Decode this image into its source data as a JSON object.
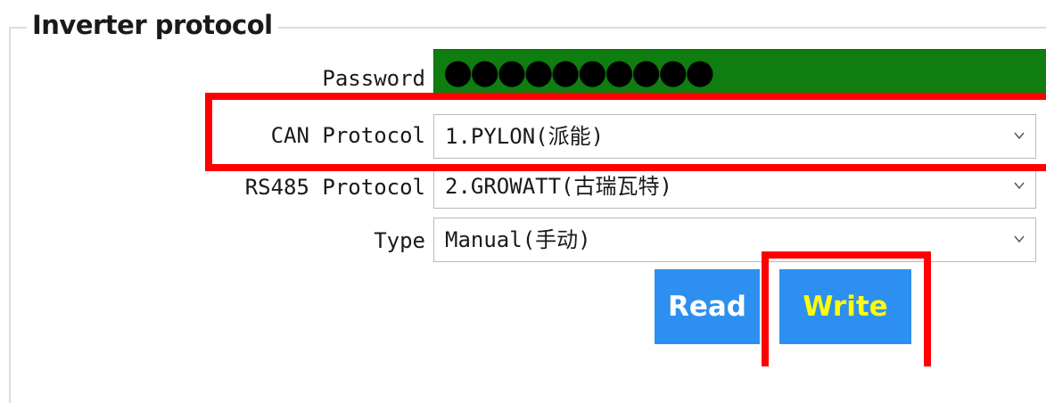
{
  "group": {
    "title": "Inverter protocol"
  },
  "password": {
    "label": "Password",
    "value": "●●●●●●●●●●"
  },
  "can_protocol": {
    "label": "CAN Protocol",
    "value": "1.PYLON(派能)"
  },
  "rs485_protocol": {
    "label": "RS485 Protocol",
    "value": "2.GROWATT(古瑞瓦特)"
  },
  "type": {
    "label": "Type",
    "value": "Manual(手动)"
  },
  "buttons": {
    "read": "Read",
    "write": "Write"
  },
  "colors": {
    "password_bg": "#0f7d0f",
    "button_bg": "#2d8ff0",
    "write_label": "#ffff00",
    "highlight": "#ff0000"
  }
}
